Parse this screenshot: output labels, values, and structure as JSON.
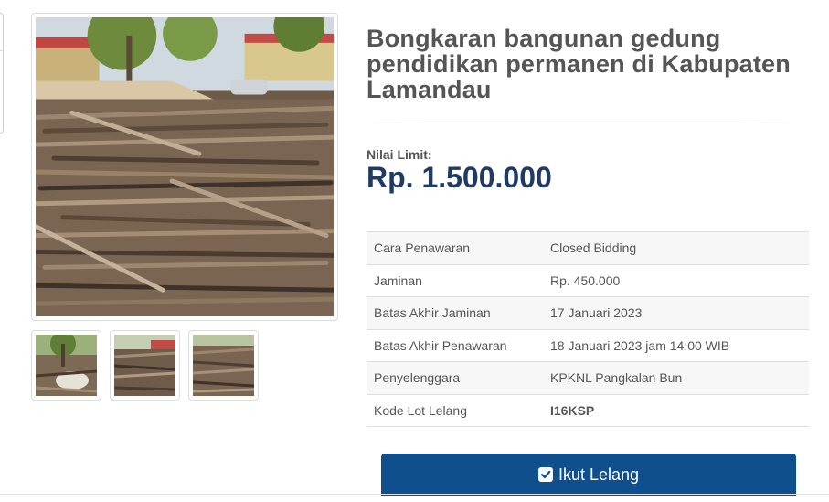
{
  "lot": {
    "title": "Bongkaran bangunan gedung pendidikan permanen di Kabupaten Lamandau",
    "limit_label": "Nilai Limit:",
    "limit_value": "Rp. 1.500.000"
  },
  "details": [
    {
      "label": "Cara Penawaran",
      "value": "Closed Bidding"
    },
    {
      "label": "Jaminan",
      "value": "Rp. 450.000"
    },
    {
      "label": "Batas Akhir Jaminan",
      "value": "17 Januari 2023"
    },
    {
      "label": "Batas Akhir Penawaran",
      "value": "18 Januari 2023 jam 14:00 WIB"
    },
    {
      "label": "Penyelenggara",
      "value": "KPKNL Pangkalan Bun"
    },
    {
      "label": "Kode Lot Lelang",
      "value": "I16KSP"
    }
  ],
  "actions": {
    "bid_label": "Ikut Lelang",
    "bid_icon": "check-square-icon",
    "bid_color": "#0f4f8e"
  },
  "colors": {
    "price": "#1f3a64",
    "link": "#1b3f6e"
  }
}
